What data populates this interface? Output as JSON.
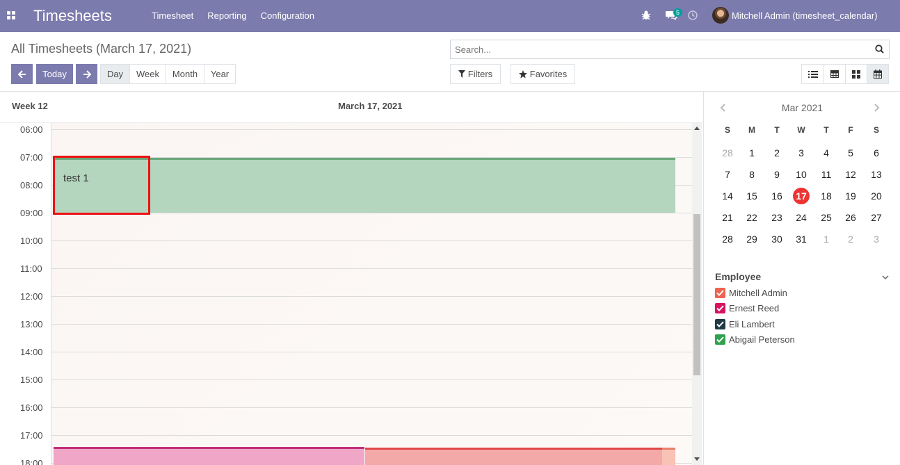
{
  "navbar": {
    "brand": "Timesheets",
    "menu": [
      "Timesheet",
      "Reporting",
      "Configuration"
    ],
    "chat_count": "5",
    "user": "Mitchell Admin (timesheet_calendar)"
  },
  "control": {
    "title": "All Timesheets (March 17, 2021)",
    "search_placeholder": "Search...",
    "today_label": "Today",
    "scales": [
      "Day",
      "Week",
      "Month",
      "Year"
    ],
    "active_scale": "Day",
    "filters_label": "Filters",
    "favorites_label": "Favorites",
    "views": [
      "list-view-icon",
      "grid-view-icon",
      "kanban-view-icon",
      "calendar-view-icon"
    ],
    "active_view": "calendar-view-icon"
  },
  "calendar": {
    "week_label": "Week 12",
    "day_label": "March 17, 2021",
    "hours": [
      "06:00",
      "07:00",
      "08:00",
      "09:00",
      "10:00",
      "11:00",
      "12:00",
      "13:00",
      "14:00",
      "15:00",
      "16:00",
      "17:00",
      "18:00"
    ],
    "events": {
      "main_title": "test 1",
      "pink_color": "#f0a6c6",
      "green_color": "#b4d5be",
      "salmon_color": "#f3a9a8"
    }
  },
  "mini_calendar": {
    "title": "Mar 2021",
    "dow": [
      "S",
      "M",
      "T",
      "W",
      "T",
      "F",
      "S"
    ],
    "weeks": [
      [
        "28",
        "1",
        "2",
        "3",
        "4",
        "5",
        "6"
      ],
      [
        "7",
        "8",
        "9",
        "10",
        "11",
        "12",
        "13"
      ],
      [
        "14",
        "15",
        "16",
        "17",
        "18",
        "19",
        "20"
      ],
      [
        "21",
        "22",
        "23",
        "24",
        "25",
        "26",
        "27"
      ],
      [
        "28",
        "29",
        "30",
        "31",
        "1",
        "2",
        "3"
      ]
    ],
    "today": "17"
  },
  "employees": {
    "title": "Employee",
    "items": [
      {
        "name": "Mitchell Admin",
        "color": "#ee6352"
      },
      {
        "name": "Ernest Reed",
        "color": "#d6145f"
      },
      {
        "name": "Eli Lambert",
        "color": "#1f3a44"
      },
      {
        "name": "Abigail Peterson",
        "color": "#30a14e"
      }
    ]
  }
}
